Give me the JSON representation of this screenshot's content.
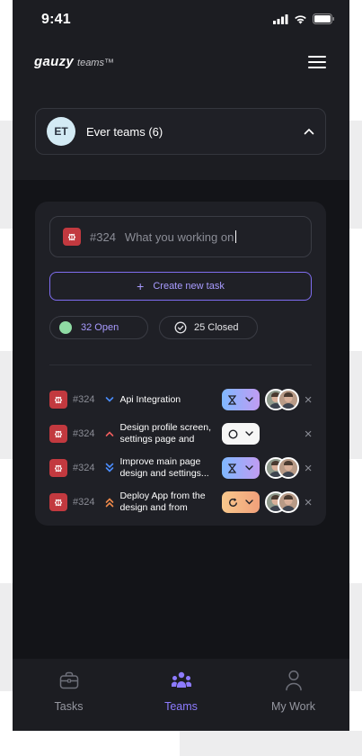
{
  "status_bar": {
    "time": "9:41"
  },
  "app": {
    "logo_main": "gauzy",
    "logo_sub": "teams™"
  },
  "team_selector": {
    "initials": "ET",
    "name": "Ever teams (6)"
  },
  "task_input": {
    "number": "#324",
    "placeholder": "What you working on"
  },
  "create_task": {
    "label": "Create new task"
  },
  "filters": {
    "open_label": "32 Open",
    "closed_label": "25 Closed"
  },
  "tasks": [
    {
      "number": "#324",
      "priority": "medium",
      "title": "Api Integration",
      "status": "blue",
      "has_avatars": true
    },
    {
      "number": "#324",
      "priority": "high",
      "title": "Design profile screen, settings page and",
      "status": "white",
      "has_avatars": false
    },
    {
      "number": "#324",
      "priority": "low",
      "title": "Improve main page design and settings...",
      "status": "blue",
      "has_avatars": true
    },
    {
      "number": "#324",
      "priority": "urgent",
      "title": "Deploy App from the design and from",
      "status": "orange",
      "has_avatars": true
    }
  ],
  "bottom_nav": [
    {
      "label": "Tasks",
      "icon": "briefcase-icon",
      "active": false
    },
    {
      "label": "Teams",
      "icon": "people-icon",
      "active": true
    },
    {
      "label": "My Work",
      "icon": "user-icon",
      "active": false
    }
  ],
  "colors": {
    "accent": "#8d7bff",
    "background": "#131418",
    "card": "#1f2026",
    "bug_badge": "#c2393f",
    "open_dot": "#8fdba4"
  }
}
